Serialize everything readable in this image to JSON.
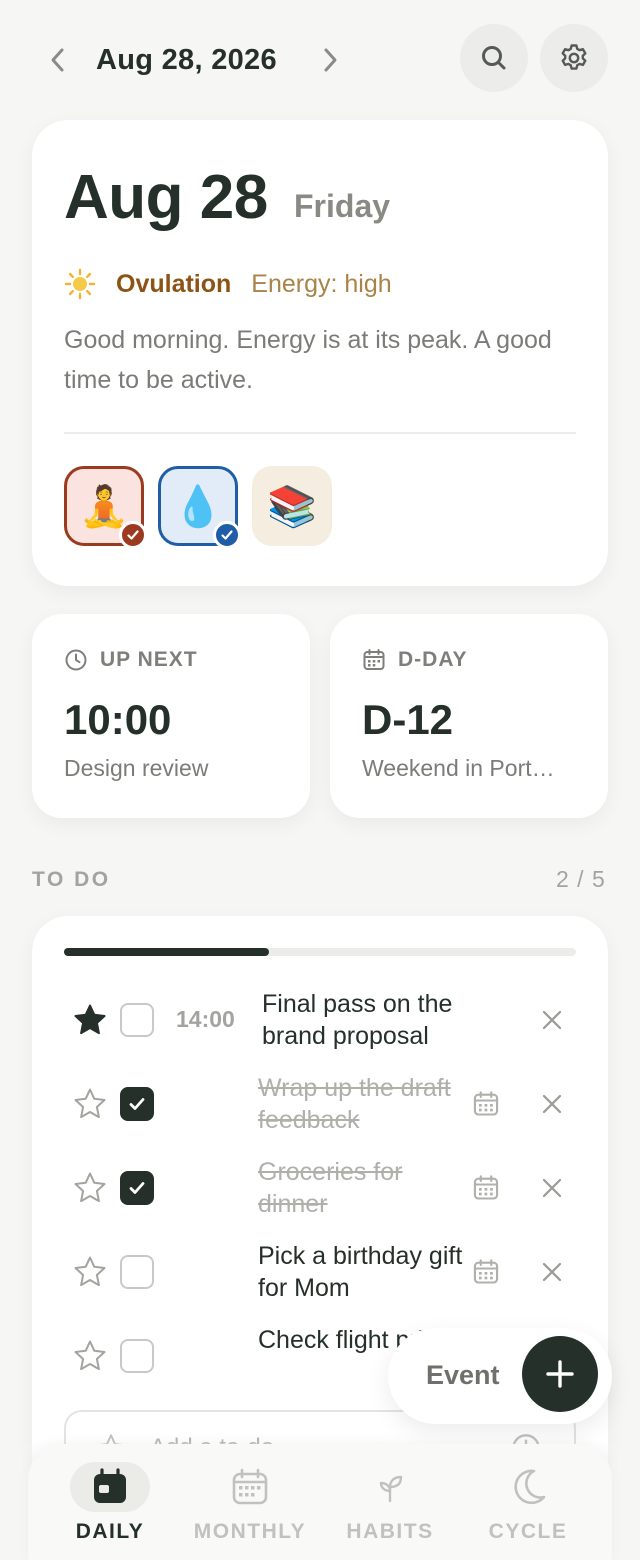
{
  "header": {
    "date": "Aug 28, 2026",
    "prev_icon": "chevron-left-icon",
    "next_icon": "chevron-right-icon",
    "search_icon": "search-icon",
    "settings_icon": "gear-icon"
  },
  "hero": {
    "date": "Aug 28",
    "weekday": "Friday",
    "phase_icon": "sun-icon",
    "phase": "Ovulation",
    "energy": "Energy: high",
    "message": "Good morning. Energy is at its peak. A good time to be active.",
    "habits": [
      {
        "emoji": "🧘",
        "name": "meditation",
        "done": true,
        "color": "#9c3a20"
      },
      {
        "emoji": "💧",
        "name": "water",
        "done": true,
        "color": "#1f5ea6"
      },
      {
        "emoji": "📚",
        "name": "reading",
        "done": false
      }
    ]
  },
  "up_next": {
    "label": "UP NEXT",
    "time": "10:00",
    "title": "Design review"
  },
  "d_day": {
    "label": "D-DAY",
    "value": "D-12",
    "title": "Weekend in Port…"
  },
  "todo": {
    "section_label": "TO DO",
    "count": "2 / 5",
    "progress": 0.4,
    "items": [
      {
        "starred": true,
        "done": false,
        "time": "14:00",
        "text": "Final pass on the brand proposal",
        "has_calendar": false
      },
      {
        "starred": false,
        "done": true,
        "time": "",
        "text": "Wrap up the draft feedback",
        "has_calendar": true
      },
      {
        "starred": false,
        "done": true,
        "time": "",
        "text": "Groceries for dinner",
        "has_calendar": true
      },
      {
        "starred": false,
        "done": false,
        "time": "",
        "text": "Pick a birthday gift for Mom",
        "has_calendar": true
      },
      {
        "starred": false,
        "done": false,
        "time": "",
        "text": "Check flight prices",
        "has_calendar": false
      }
    ],
    "add_placeholder": "Add a to-do"
  },
  "fab": {
    "label": "Event"
  },
  "bottom_nav": {
    "items": [
      {
        "label": "DAILY",
        "icon": "calendar-day-icon",
        "active": true
      },
      {
        "label": "MONTHLY",
        "icon": "calendar-month-icon",
        "active": false
      },
      {
        "label": "HABITS",
        "icon": "sprout-icon",
        "active": false
      },
      {
        "label": "CYCLE",
        "icon": "moon-icon",
        "active": false
      }
    ]
  },
  "colors": {
    "ink": "#243029",
    "phase": "#8c5414",
    "energy": "#a98348",
    "background": "#f6f6f5"
  }
}
